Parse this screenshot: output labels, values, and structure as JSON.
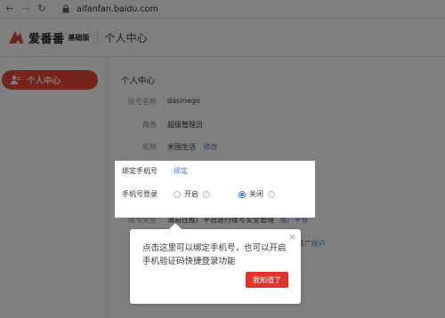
{
  "browser": {
    "url": "aifanfan.baidu.com"
  },
  "header": {
    "logo_text": "爱番番",
    "logo_badge": "基础版",
    "title": "个人中心"
  },
  "sidebar": {
    "items": [
      {
        "label": "个人中心"
      }
    ]
  },
  "profile": {
    "section_title": "个人中心",
    "fields": [
      {
        "label": "账号名称",
        "value": "dasmego"
      },
      {
        "label": "角色",
        "value": "超级管理员"
      },
      {
        "label": "昵称",
        "value": "米国生活",
        "action": "修改"
      }
    ],
    "hidden_rows": [
      {
        "label": "账号安全",
        "value": "请前往推广平台进行账号安全管理",
        "action": "推广平台"
      },
      {
        "action": "推广账户"
      }
    ]
  },
  "phone_card": {
    "bind_label": "绑定手机号",
    "bind_action": "绑定",
    "login_label": "手机号登录",
    "option_on": "开启",
    "option_off": "关闭",
    "selected": "关闭"
  },
  "tooltip": {
    "text": "点击这里可以绑定手机号，也可以开启手机验证码快捷登录功能",
    "button": "我知道了"
  },
  "colors": {
    "accent": "#e8483a",
    "link": "#3a78d8",
    "button": "#e2322d"
  }
}
